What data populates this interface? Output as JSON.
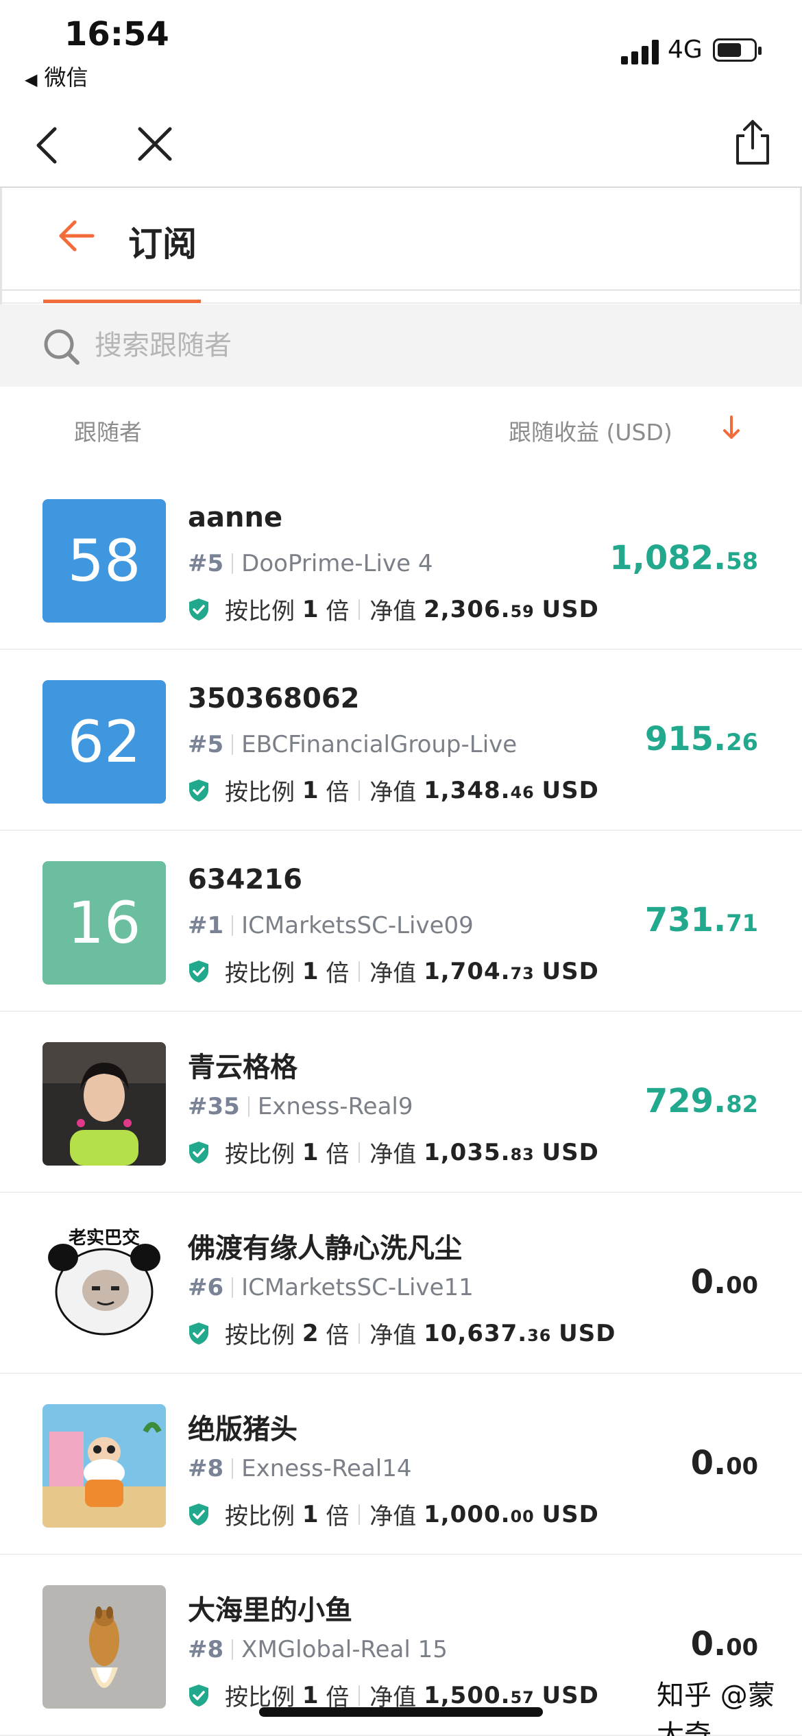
{
  "status_bar": {
    "time": "16:54",
    "back_app": "微信",
    "network": "4G"
  },
  "page": {
    "title": "订阅"
  },
  "search": {
    "placeholder": "搜索跟随者"
  },
  "columns": {
    "follower": "跟随者",
    "profit": "跟随收益 (USD)"
  },
  "colors": {
    "accent": "#f26b3a",
    "profit_green": "#22a88c",
    "avatar_blue": "#3f97e0",
    "avatar_teal": "#6bbf9f"
  },
  "followers": [
    {
      "avatar_type": "number",
      "avatar_text": "58",
      "avatar_color": "#3f97e0",
      "name": "aanne",
      "rank": "#5",
      "server": "DooPrime-Live 4",
      "ratio_label": "按比例",
      "ratio_value": "1",
      "ratio_unit": "倍",
      "equity_label": "净值",
      "equity_value": "2,306.59",
      "equity_currency": "USD",
      "profit": "1,082.58",
      "profit_state": "positive"
    },
    {
      "avatar_type": "number",
      "avatar_text": "62",
      "avatar_color": "#3f97e0",
      "name": "350368062",
      "rank": "#5",
      "server": "EBCFinancialGroup-Live",
      "ratio_label": "按比例",
      "ratio_value": "1",
      "ratio_unit": "倍",
      "equity_label": "净值",
      "equity_value": "1,348.46",
      "equity_currency": "USD",
      "profit": "915.26",
      "profit_state": "positive"
    },
    {
      "avatar_type": "number",
      "avatar_text": "16",
      "avatar_color": "#6bbf9f",
      "name": "634216",
      "rank": "#1",
      "server": "ICMarketsSC-Live09",
      "ratio_label": "按比例",
      "ratio_value": "1",
      "ratio_unit": "倍",
      "equity_label": "净值",
      "equity_value": "1,704.73",
      "equity_currency": "USD",
      "profit": "731.71",
      "profit_state": "positive"
    },
    {
      "avatar_type": "photo-woman",
      "name": "青云格格",
      "rank": "#35",
      "server": "Exness-Real9",
      "ratio_label": "按比例",
      "ratio_value": "1",
      "ratio_unit": "倍",
      "equity_label": "净值",
      "equity_value": "1,035.83",
      "equity_currency": "USD",
      "profit": "729.82",
      "profit_state": "positive"
    },
    {
      "avatar_type": "panda-meme",
      "avatar_caption": "老实巴交",
      "name": "佛渡有缘人静心洗凡尘",
      "rank": "#6",
      "server": "ICMarketsSC-Live11",
      "ratio_label": "按比例",
      "ratio_value": "2",
      "ratio_unit": "倍",
      "equity_label": "净值",
      "equity_value": "10,637.36",
      "equity_currency": "USD",
      "profit": "0.00",
      "profit_state": "zero"
    },
    {
      "avatar_type": "cartoon-old-man",
      "name": "绝版猪头",
      "rank": "#8",
      "server": "Exness-Real14",
      "ratio_label": "按比例",
      "ratio_value": "1",
      "ratio_unit": "倍",
      "equity_label": "净值",
      "equity_value": "1,000.00",
      "equity_currency": "USD",
      "profit": "0.00",
      "profit_state": "zero"
    },
    {
      "avatar_type": "rocket-dog",
      "name": "大海里的小鱼",
      "rank": "#8",
      "server": "XMGlobal-Real 15",
      "ratio_label": "按比例",
      "ratio_value": "1",
      "ratio_unit": "倍",
      "equity_label": "净值",
      "equity_value": "1,500.57",
      "equity_currency": "USD",
      "profit": "0.00",
      "profit_state": "zero"
    }
  ],
  "watermark": "知乎 @蒙太奇"
}
